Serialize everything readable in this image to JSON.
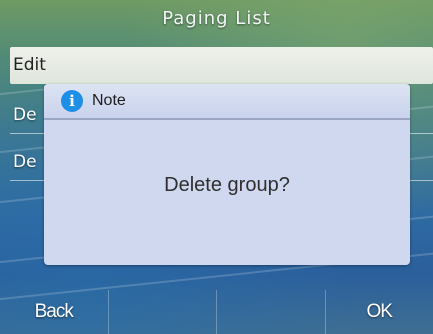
{
  "title": "Paging List",
  "list": {
    "items": [
      {
        "label": "Edit"
      },
      {
        "label": "De"
      },
      {
        "label": "De"
      }
    ]
  },
  "dialog": {
    "title": "Note",
    "icon": "info-icon",
    "message": "Delete group?"
  },
  "softkeys": {
    "keys": [
      {
        "label": "Back"
      },
      {
        "label": ""
      },
      {
        "label": ""
      },
      {
        "label": "OK"
      }
    ]
  },
  "colors": {
    "dialog_background": "#cfd8ee",
    "info_icon": "#1e8fe6",
    "selected_row": "#e6ebe3"
  }
}
